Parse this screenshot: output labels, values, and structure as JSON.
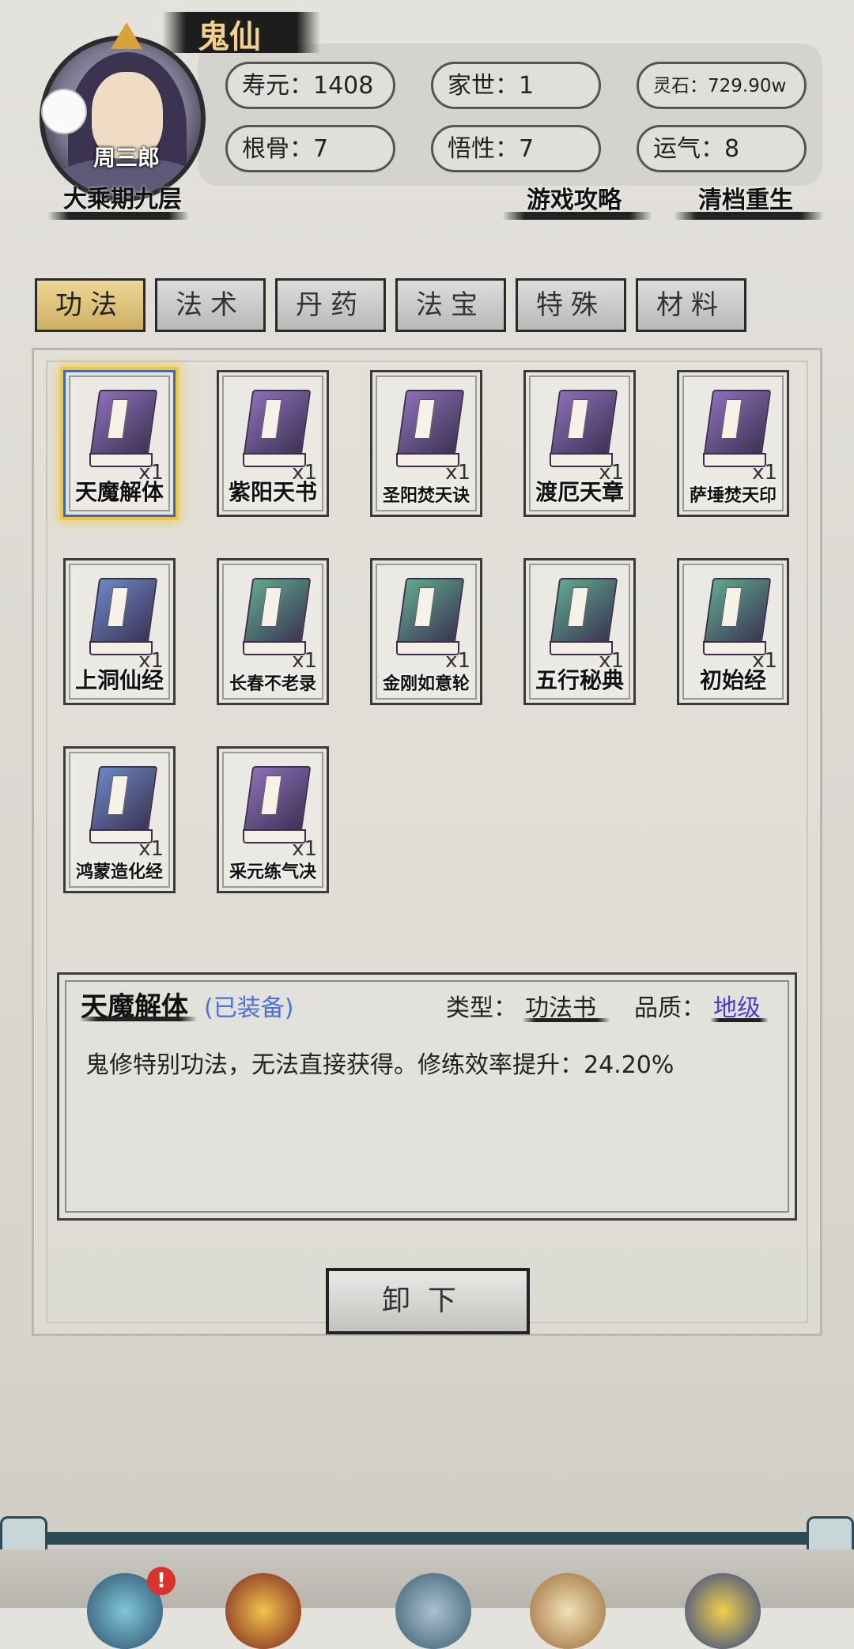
{
  "header": {
    "title": "鬼仙",
    "character_name": "周三郎",
    "realm": "大乘期九层",
    "stats": {
      "lifespan": "寿元：1408",
      "family": "家世：1",
      "spirit_stones": "灵石：729.90w",
      "bone": "根骨：7",
      "comprehension": "悟性：7",
      "luck": "运气：8"
    },
    "links": {
      "guide": "游戏攻略",
      "rebirth": "清档重生"
    }
  },
  "tabs": [
    {
      "label": "功法",
      "active": true
    },
    {
      "label": "法术",
      "active": false
    },
    {
      "label": "丹药",
      "active": false
    },
    {
      "label": "法宝",
      "active": false
    },
    {
      "label": "特殊",
      "active": false
    },
    {
      "label": "材料",
      "active": false
    }
  ],
  "items": [
    {
      "name": "天魔解体",
      "qty": "x1",
      "color": "purple",
      "selected": true
    },
    {
      "name": "紫阳天书",
      "qty": "x1",
      "color": "purple"
    },
    {
      "name": "圣阳焚天诀",
      "qty": "x1",
      "color": "purple"
    },
    {
      "name": "渡厄天章",
      "qty": "x1",
      "color": "purple"
    },
    {
      "name": "萨埵焚天印",
      "qty": "x1",
      "color": "purple"
    },
    {
      "name": "上洞仙经",
      "qty": "x1",
      "color": "blue"
    },
    {
      "name": "长春不老录",
      "qty": "x1",
      "color": "green"
    },
    {
      "name": "金刚如意轮",
      "qty": "x1",
      "color": "green"
    },
    {
      "name": "五行秘典",
      "qty": "x1",
      "color": "green"
    },
    {
      "name": "初始经",
      "qty": "x1",
      "color": "green"
    },
    {
      "name": "鸿蒙造化经",
      "qty": "x1",
      "color": "blue"
    },
    {
      "name": "采元练气决",
      "qty": "x1",
      "color": "purple"
    }
  ],
  "book_colors": {
    "purple": "#8c6fb8",
    "blue": "#6a87c4",
    "green": "#5fa88f"
  },
  "detail": {
    "item_name": "天魔解体",
    "status": "(已装备)",
    "type_label": "类型：",
    "type_value": "功法书",
    "quality_label": "品质：",
    "quality_value": "地级",
    "description": "鬼修特别功法，无法直接获得。修练效率提升：24.20%"
  },
  "unload_button": "卸下",
  "nav": {
    "badge": "!"
  }
}
